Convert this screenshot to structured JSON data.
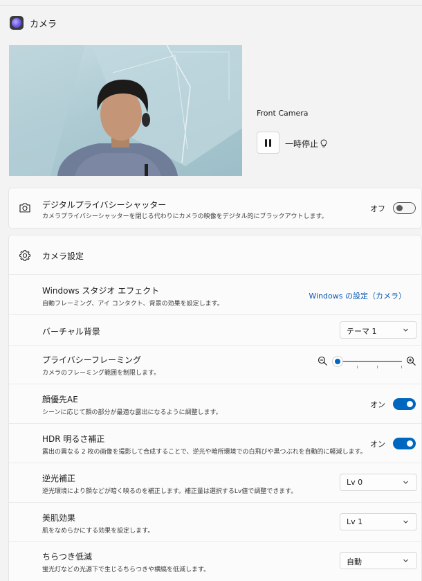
{
  "app": {
    "title": "カメラ"
  },
  "camera": {
    "name": "Front Camera",
    "pause_label": "一時停止"
  },
  "privacy_shutter": {
    "title": "デジタルプライバシーシャッター",
    "desc": "カメラプライバシーシャッターを閉じる代わりにカメラの映像をデジタル的にブラックアウトします。",
    "state": "オフ"
  },
  "settings": {
    "header": "カメラ設定",
    "studio": {
      "title": "Windows スタジオ エフェクト",
      "desc": "自動フレーミング、アイ コンタクト、背景の効果を設定します。",
      "link": "Windows の設定（カメラ）"
    },
    "virtual_bg": {
      "title": "バーチャル背景",
      "value": "テーマ 1"
    },
    "privacy_framing": {
      "title": "プライバシーフレーミング",
      "desc": "カメラのフレーミング範囲を制限します。",
      "level": 0
    },
    "face_ae": {
      "title": "顔優先AE",
      "desc": "シーンに応じて顔の部分が最適な露出になるように調整します。",
      "state": "オン"
    },
    "hdr": {
      "title": "HDR 明るさ補正",
      "desc": "露出の異なる 2 枚の画像を撮影して合成することで、逆光や暗所環境での白飛びや黒つぶれを自動的に軽減します。",
      "state": "オン"
    },
    "backlight": {
      "title": "逆光補正",
      "desc": "逆光環境により顔などが暗く映るのを補正します。補正量は選択するLv値で調整できます。",
      "value": "Lv 0"
    },
    "skin": {
      "title": "美肌効果",
      "desc": "肌をなめらかにする効果を設定します。",
      "value": "Lv 1"
    },
    "flicker": {
      "title": "ちらつき低減",
      "desc": "蛍光灯などの光源下で生じるちらつきや横縞を低減します。",
      "value": "自動"
    }
  },
  "colors": {
    "accent": "#0067c0",
    "link": "#0a5bb5",
    "background": "#f3f3f3",
    "card": "#fbfbfb"
  },
  "icons": [
    "camera-app-icon",
    "pause-icon",
    "lightbulb-icon",
    "camera-icon",
    "gear-icon",
    "chevron-down-icon",
    "zoom-out-icon",
    "zoom-in-icon"
  ]
}
